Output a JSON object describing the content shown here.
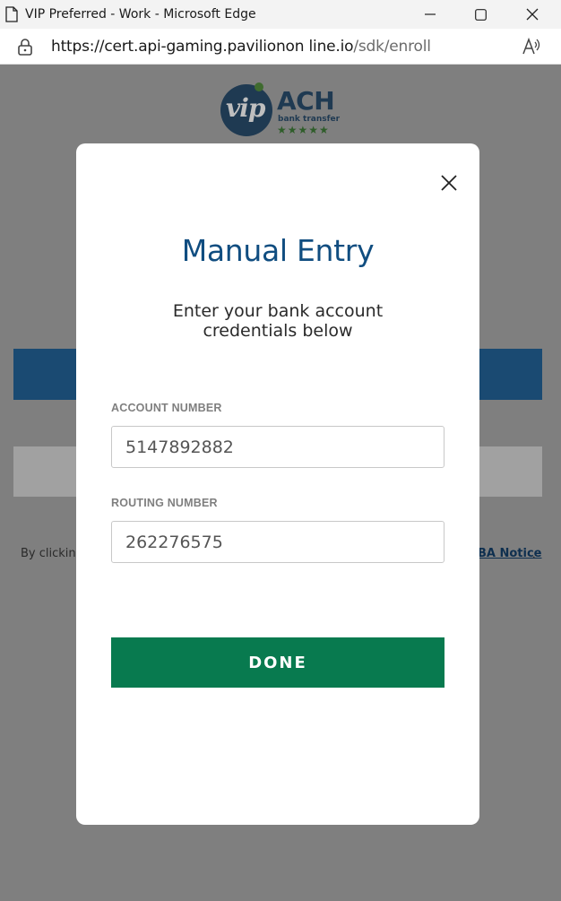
{
  "window": {
    "title": "VIP Preferred - Work - Microsoft Edge"
  },
  "addressbar": {
    "url_host": "https://cert.api-gaming.pavilionon line.io",
    "url_path": "/sdk/enroll"
  },
  "background": {
    "logo": {
      "circle_text": "vip",
      "ach": "ACH",
      "sub": "bank transfer",
      "stars": "★★★★★"
    },
    "text_left": "By clickin",
    "text_right": "BA Notice",
    "text_right_dot": "."
  },
  "modal": {
    "title": "Manual Entry",
    "subtitle": "Enter your bank account credentials below",
    "account_label": "ACCOUNT NUMBER",
    "account_value": "5147892882",
    "routing_label": "ROUTING NUMBER",
    "routing_value": "262276575",
    "done_label": "DONE"
  },
  "colors": {
    "brand_blue": "#104d80",
    "done_green": "#087a4f",
    "overlay": "#7f7f7f"
  }
}
